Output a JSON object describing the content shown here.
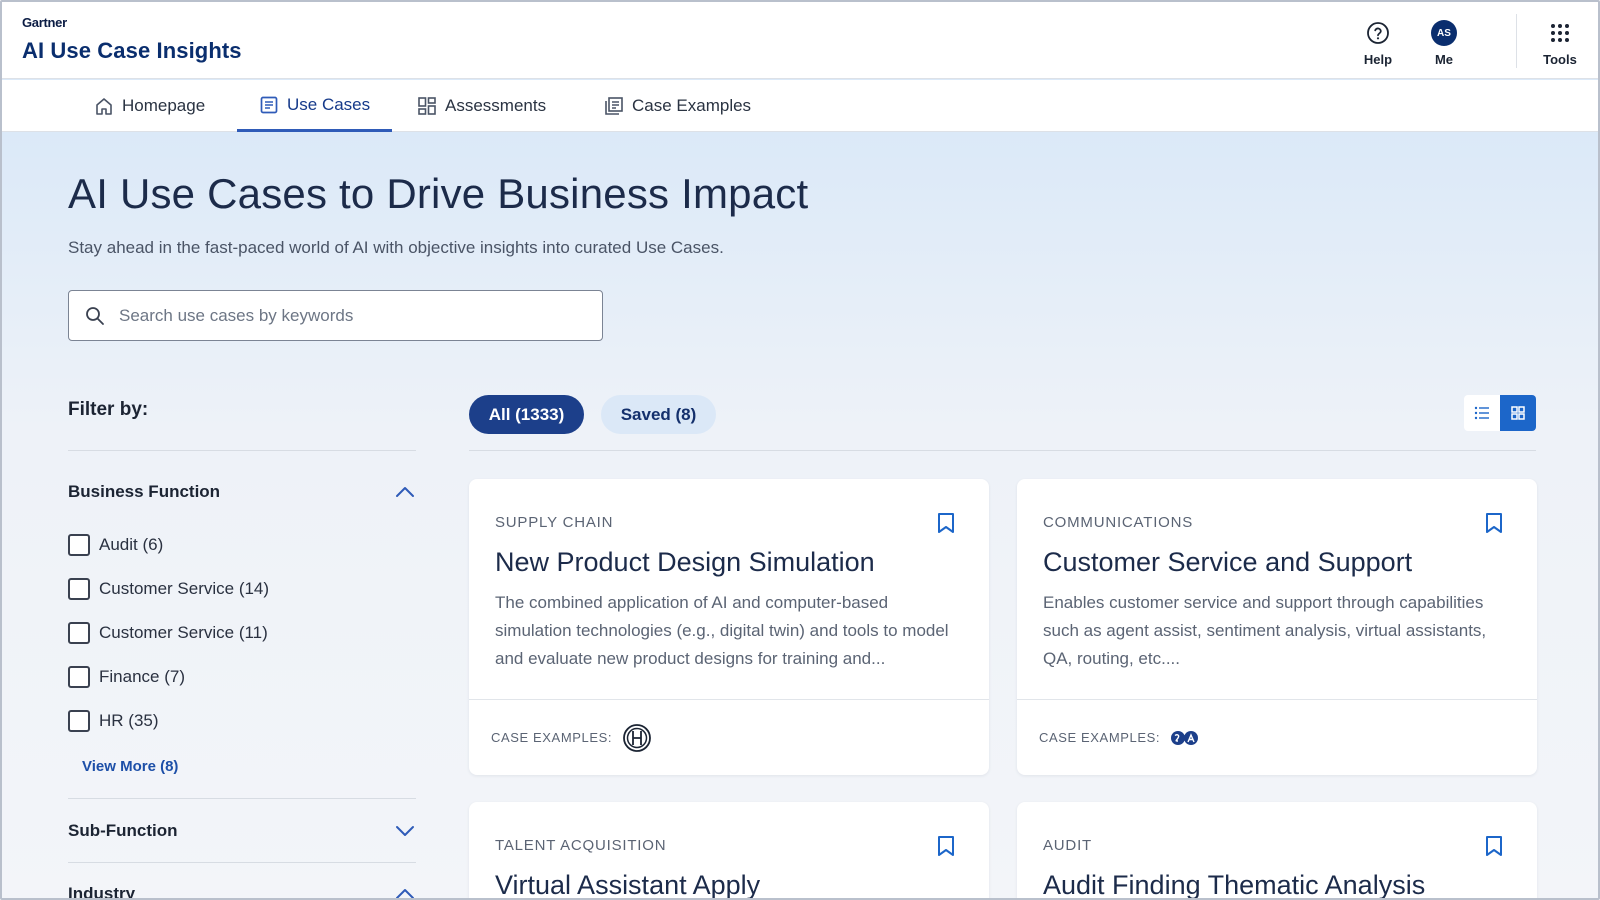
{
  "header": {
    "brand": "Gartner",
    "app_title": "AI Use Case Insights",
    "actions": [
      {
        "label": "Help",
        "icon": "help-circle-icon"
      },
      {
        "label": "Me",
        "avatar_initials": "AS"
      },
      {
        "label": "Tools",
        "icon": "grid-dots-icon"
      }
    ]
  },
  "nav": {
    "tabs": [
      {
        "label": "Homepage",
        "icon": "home-icon",
        "active": false
      },
      {
        "label": "Use Cases",
        "icon": "document-icon",
        "active": true
      },
      {
        "label": "Assessments",
        "icon": "dashboard-icon",
        "active": false
      },
      {
        "label": "Case Examples",
        "icon": "library-icon",
        "active": false
      }
    ]
  },
  "hero": {
    "title": "AI Use Cases to Drive Business Impact",
    "subtitle": "Stay ahead in the fast-paced world of AI with objective insights into curated Use Cases.",
    "search_placeholder": "Search use cases by keywords"
  },
  "filters": {
    "title": "Filter by:",
    "business_function": {
      "label": "Business Function",
      "expanded": true,
      "options": [
        "Audit (6)",
        "Customer Service (14)",
        "Customer Service (11)",
        "Finance (7)",
        "HR (35)"
      ],
      "view_more": "View More (8)"
    },
    "sub_function": {
      "label": "Sub-Function",
      "expanded": false
    },
    "industry": {
      "label": "Industry",
      "expanded": true
    }
  },
  "tabs": {
    "all": "All (1333)",
    "saved": "Saved (8)",
    "active": "all",
    "view_mode": "grid"
  },
  "cards": [
    {
      "category": "SUPPLY CHAIN",
      "title": "New Product Design Simulation",
      "description": "The combined application of AI and computer-based simulation technologies (e.g., digital twin) and tools to model and evaluate new product designs for training and...",
      "footer_label": "CASE EXAMPLES:",
      "logo": "bosch-logo-icon"
    },
    {
      "category": "COMMUNICATIONS",
      "title": "Customer Service and Support",
      "description": "Enables customer service and support through capabilities such as agent assist, sentiment analysis, virtual assistants, QA, routing, etc....",
      "footer_label": "CASE EXAMPLES:",
      "logo": "company-logo-icon"
    },
    {
      "category": "TALENT ACQUISITION",
      "title": "Virtual Assistant Apply"
    },
    {
      "category": "AUDIT",
      "title": "Audit Finding Thematic Analysis"
    }
  ],
  "colors": {
    "primary": "#1c3f8a",
    "accent": "#1c66c9",
    "link": "#1d4fa8",
    "title_blue": "#0a2e6e"
  }
}
